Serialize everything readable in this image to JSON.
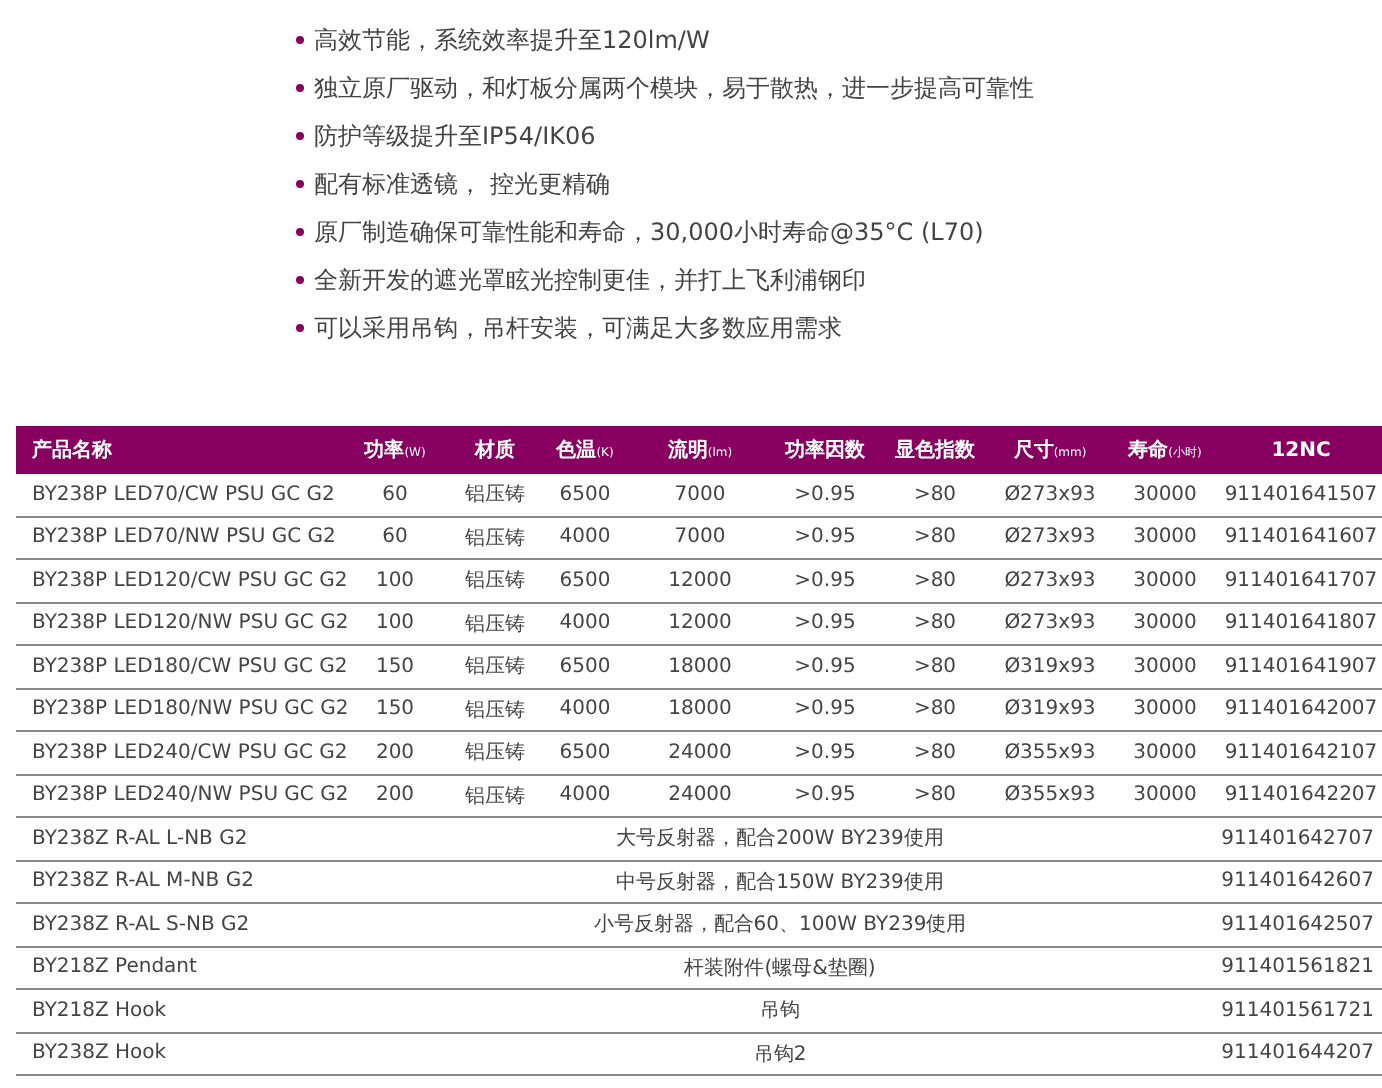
{
  "features": [
    "高效节能，系统效率提升至120lm/W",
    "独立原厂驱动，和灯板分属两个模块，易于散热，进一步提高可靠性",
    "防护等级提升至IP54/IK06",
    "配有标准透镜， 控光更精确",
    "原厂制造确保可靠性能和寿命，30,000小时寿命@35°C (L70)",
    "全新开发的遮光罩眩光控制更佳，并打上飞利浦钢印",
    "可以采用吊钩，吊杆安装，可满足大多数应用需求"
  ],
  "table": {
    "columns": [
      {
        "label": "产品名称"
      },
      {
        "label": "功率",
        "unit": "(W)"
      },
      {
        "label": "材质"
      },
      {
        "label": "色温",
        "unit": "(K)"
      },
      {
        "label": "流明",
        "unit": "(lm)"
      },
      {
        "label": "功率因数"
      },
      {
        "label": "显色指数"
      },
      {
        "label": "尺寸",
        "unit": "(mm)"
      },
      {
        "label": "寿命",
        "unit": "(小时)"
      },
      {
        "label": "12NC"
      }
    ],
    "rows": [
      {
        "kind": "product",
        "cells": [
          "BY238P LED70/CW PSU GC G2",
          "60",
          "铝压铸",
          "6500",
          "7000",
          ">0.95",
          ">80",
          "Ø273x93",
          "30000",
          "911401641507"
        ]
      },
      {
        "kind": "product",
        "cells": [
          "BY238P LED70/NW PSU GC G2",
          "60",
          "铝压铸",
          "4000",
          "7000",
          ">0.95",
          ">80",
          "Ø273x93",
          "30000",
          "911401641607"
        ]
      },
      {
        "kind": "product",
        "cells": [
          "BY238P LED120/CW PSU GC G2",
          "100",
          "铝压铸",
          "6500",
          "12000",
          ">0.95",
          ">80",
          "Ø273x93",
          "30000",
          "911401641707"
        ]
      },
      {
        "kind": "product",
        "cells": [
          "BY238P LED120/NW PSU GC G2",
          "100",
          "铝压铸",
          "4000",
          "12000",
          ">0.95",
          ">80",
          "Ø273x93",
          "30000",
          "911401641807"
        ]
      },
      {
        "kind": "product",
        "cells": [
          "BY238P LED180/CW PSU GC G2",
          "150",
          "铝压铸",
          "6500",
          "18000",
          ">0.95",
          ">80",
          "Ø319x93",
          "30000",
          "911401641907"
        ]
      },
      {
        "kind": "product",
        "cells": [
          "BY238P LED180/NW PSU GC G2",
          "150",
          "铝压铸",
          "4000",
          "18000",
          ">0.95",
          ">80",
          "Ø319x93",
          "30000",
          "911401642007"
        ]
      },
      {
        "kind": "product",
        "cells": [
          "BY238P LED240/CW PSU GC G2",
          "200",
          "铝压铸",
          "6500",
          "24000",
          ">0.95",
          ">80",
          "Ø355x93",
          "30000",
          "911401642107"
        ]
      },
      {
        "kind": "product",
        "cells": [
          "BY238P LED240/NW PSU GC G2",
          "200",
          "铝压铸",
          "4000",
          "24000",
          ">0.95",
          ">80",
          "Ø355x93",
          "30000",
          "911401642207"
        ]
      },
      {
        "kind": "accessory",
        "cells": [
          "BY238Z R-AL L-NB G2",
          {
            "text": "大号反射器，配合200W BY239使用",
            "colspan": 8
          },
          "911401642707"
        ]
      },
      {
        "kind": "accessory",
        "cells": [
          "BY238Z R-AL M-NB G2",
          {
            "text": "中号反射器，配合150W BY239使用",
            "colspan": 8
          },
          "911401642607"
        ]
      },
      {
        "kind": "accessory",
        "cells": [
          "BY238Z R-AL S-NB G2",
          {
            "text": "小号反射器，配合60、100W BY239使用",
            "colspan": 8
          },
          "911401642507"
        ]
      },
      {
        "kind": "accessory",
        "cells": [
          "BY218Z Pendant",
          {
            "text": "杆装附件(螺母&垫圈)",
            "colspan": 8
          },
          "911401561821"
        ]
      },
      {
        "kind": "accessory",
        "cells": [
          "BY218Z Hook",
          {
            "text": "吊钩",
            "colspan": 8
          },
          "911401561721"
        ]
      },
      {
        "kind": "accessory",
        "cells": [
          "BY238Z Hook",
          {
            "text": "吊钩2",
            "colspan": 8
          },
          "911401644207"
        ]
      }
    ]
  }
}
